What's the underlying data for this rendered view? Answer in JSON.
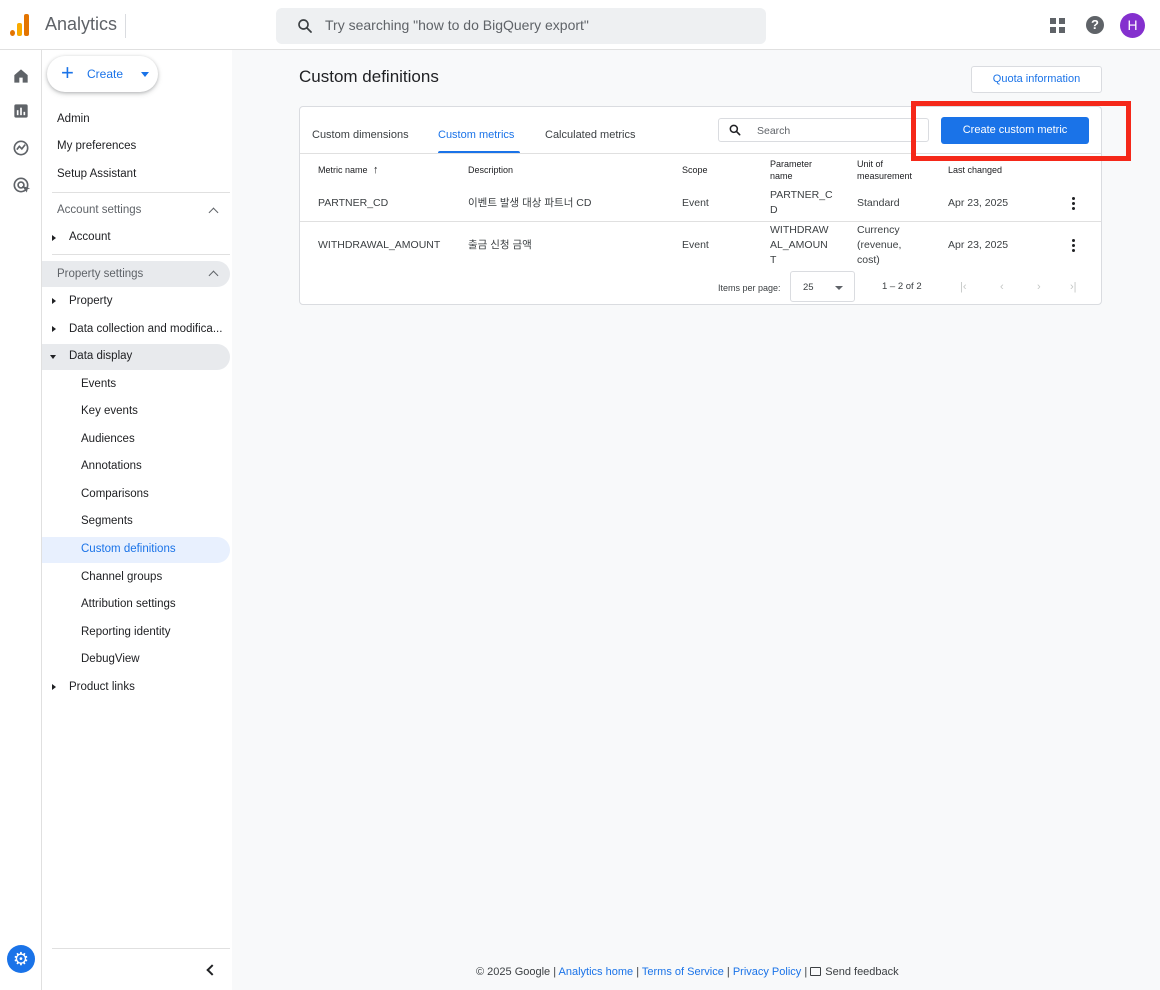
{
  "app": {
    "name": "Analytics"
  },
  "search": {
    "placeholder": "Try searching \"how to do BigQuery export\""
  },
  "header": {
    "avatar_initial": "H",
    "help_glyph": "?"
  },
  "sidebar": {
    "create_label": "Create",
    "top_items": [
      "Admin",
      "My preferences",
      "Setup Assistant"
    ],
    "account_settings": {
      "label": "Account settings",
      "items": [
        "Account"
      ]
    },
    "property_settings": {
      "label": "Property settings",
      "items": [
        "Property",
        "Data collection and modifica...",
        "Data display"
      ],
      "data_display_children": [
        "Events",
        "Key events",
        "Audiences",
        "Annotations",
        "Comparisons",
        "Segments",
        "Custom definitions",
        "Channel groups",
        "Attribution settings",
        "Reporting identity",
        "DebugView"
      ],
      "after": [
        "Product links"
      ]
    },
    "active_item": "Custom definitions"
  },
  "main": {
    "title": "Custom definitions",
    "quota_label": "Quota information",
    "tabs": [
      "Custom dimensions",
      "Custom metrics",
      "Calculated metrics"
    ],
    "active_tab": "Custom metrics",
    "search_placeholder": "Search",
    "create_button": "Create custom metric",
    "table": {
      "headers": {
        "metric_name": "Metric name",
        "description": "Description",
        "scope": "Scope",
        "parameter_name": [
          "Parameter",
          "name"
        ],
        "unit": [
          "Unit of",
          "measurement"
        ],
        "last_changed": "Last changed"
      },
      "sort_indicator": "↑",
      "rows": [
        {
          "metric_name": "PARTNER_CD",
          "description": "이벤트 발생 대상 파트너 CD",
          "scope": "Event",
          "parameter_lines": [
            "PARTNER_C",
            "D"
          ],
          "unit_lines": [
            "Standard"
          ],
          "last_changed": "Apr 23, 2025"
        },
        {
          "metric_name": "WITHDRAWAL_AMOUNT",
          "description": "출금 신청 금액",
          "scope": "Event",
          "parameter_lines": [
            "WITHDRAW",
            "AL_AMOUN",
            "T"
          ],
          "unit_lines": [
            "Currency",
            "(revenue,",
            "cost)"
          ],
          "last_changed": "Apr 23, 2025"
        }
      ]
    },
    "pagination": {
      "items_per_page_label": "Items per page:",
      "items_per_page_value": "25",
      "range": "1 – 2 of 2"
    }
  },
  "footer": {
    "copyright": "© 2025 Google |",
    "links": [
      "Analytics home",
      "Terms of Service",
      "Privacy Policy"
    ],
    "separator": "|",
    "feedback": "Send feedback"
  },
  "colors": {
    "accent": "#1a73e8",
    "highlight_box": "#f52819",
    "avatar": "#8430ce"
  }
}
